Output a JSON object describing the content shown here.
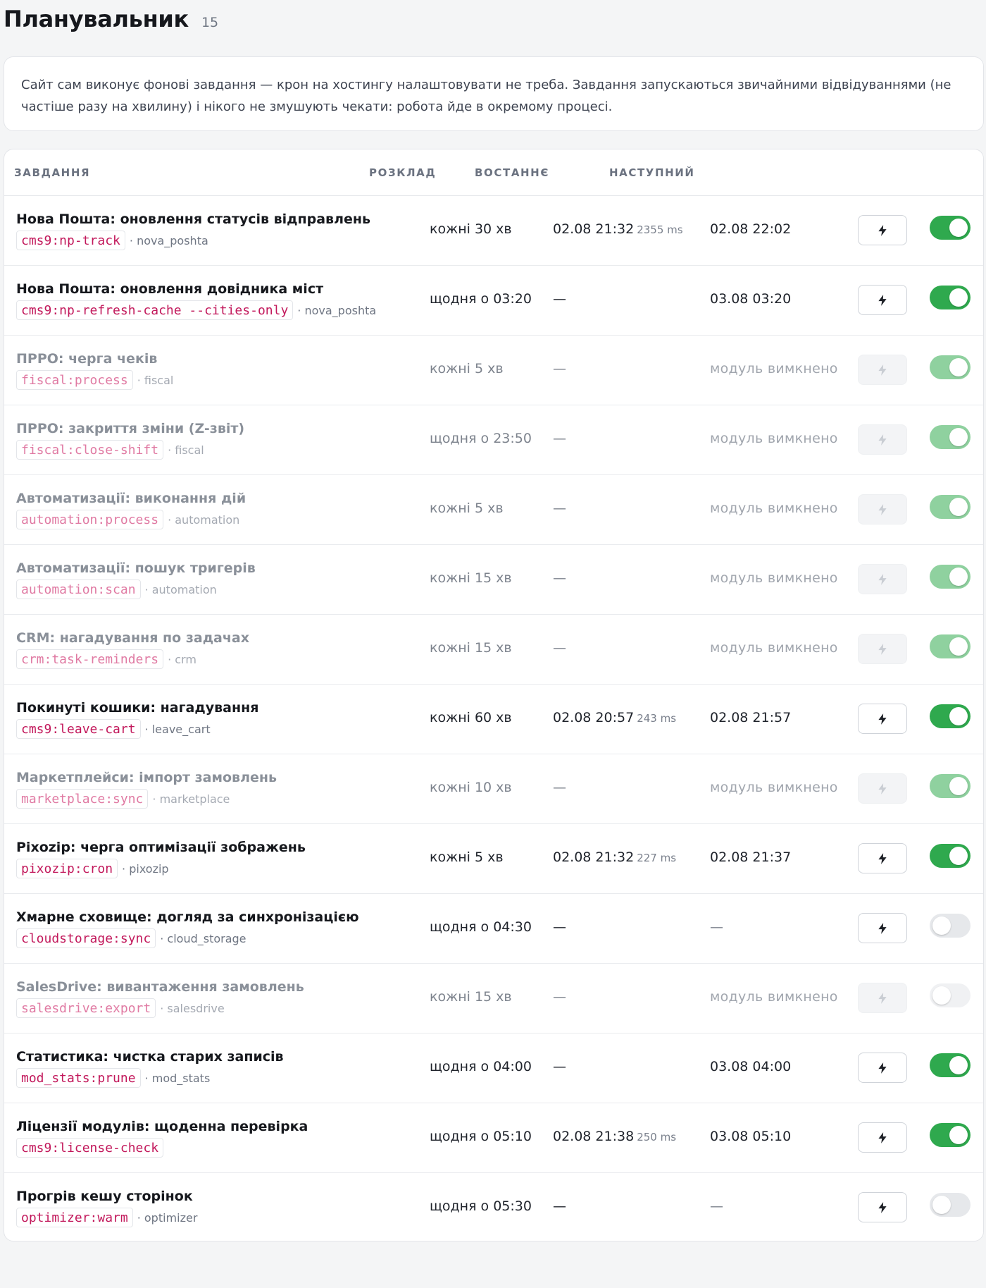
{
  "header": {
    "title": "Планувальник",
    "count": "15"
  },
  "info": {
    "text": "Сайт сам виконує фонові завдання — крон на хостингу налаштовувати не треба. Завдання запускаються звичайними відвідуваннями (не частіше разу на хвилину) і нікого не змушують чекати: робота йде в окремому процесі."
  },
  "table": {
    "columns": {
      "task": "ЗАВДАННЯ",
      "schedule": "РОЗКЛАД",
      "last": "ВОСТАННЄ",
      "next": "НАСТУПНИЙ"
    },
    "rows": [
      {
        "name": "Нова Пошта: оновлення статусів відправлень",
        "command": "cms9:np-track",
        "module": "· nova_poshta",
        "schedule": "кожні 30 хв",
        "last": "02.08 21:32",
        "duration": "2355 ms",
        "next": "02.08 22:02",
        "enabled": true,
        "module_disabled": false
      },
      {
        "name": "Нова Пошта: оновлення довідника міст",
        "command": "cms9:np-refresh-cache --cities-only",
        "module": "· nova_poshta",
        "schedule": "щодня о 03:20",
        "last": "—",
        "duration": "",
        "next": "03.08 03:20",
        "enabled": true,
        "module_disabled": false
      },
      {
        "name": "ПРРО: черга чеків",
        "command": "fiscal:process",
        "module": "· fiscal",
        "schedule": "кожні 5 хв",
        "last": "—",
        "duration": "",
        "next": "модуль вимкнено",
        "enabled": true,
        "module_disabled": true
      },
      {
        "name": "ПРРО: закриття зміни (Z-звіт)",
        "command": "fiscal:close-shift",
        "module": "· fiscal",
        "schedule": "щодня о 23:50",
        "last": "—",
        "duration": "",
        "next": "модуль вимкнено",
        "enabled": true,
        "module_disabled": true
      },
      {
        "name": "Автоматизації: виконання дій",
        "command": "automation:process",
        "module": "· automation",
        "schedule": "кожні 5 хв",
        "last": "—",
        "duration": "",
        "next": "модуль вимкнено",
        "enabled": true,
        "module_disabled": true
      },
      {
        "name": "Автоматизації: пошук тригерів",
        "command": "automation:scan",
        "module": "· automation",
        "schedule": "кожні 15 хв",
        "last": "—",
        "duration": "",
        "next": "модуль вимкнено",
        "enabled": true,
        "module_disabled": true
      },
      {
        "name": "CRM: нагадування по задачах",
        "command": "crm:task-reminders",
        "module": "· crm",
        "schedule": "кожні 15 хв",
        "last": "—",
        "duration": "",
        "next": "модуль вимкнено",
        "enabled": true,
        "module_disabled": true
      },
      {
        "name": "Покинуті кошики: нагадування",
        "command": "cms9:leave-cart",
        "module": "· leave_cart",
        "schedule": "кожні 60 хв",
        "last": "02.08 20:57",
        "duration": "243 ms",
        "next": "02.08 21:57",
        "enabled": true,
        "module_disabled": false
      },
      {
        "name": "Маркетплейси: імпорт замовлень",
        "command": "marketplace:sync",
        "module": "· marketplace",
        "schedule": "кожні 10 хв",
        "last": "—",
        "duration": "",
        "next": "модуль вимкнено",
        "enabled": true,
        "module_disabled": true
      },
      {
        "name": "Pixozip: черга оптимізації зображень",
        "command": "pixozip:cron",
        "module": "· pixozip",
        "schedule": "кожні 5 хв",
        "last": "02.08 21:32",
        "duration": "227 ms",
        "next": "02.08 21:37",
        "enabled": true,
        "module_disabled": false
      },
      {
        "name": "Хмарне сховище: догляд за синхронізацією",
        "command": "cloudstorage:sync",
        "module": "· cloud_storage",
        "schedule": "щодня о 04:30",
        "last": "—",
        "duration": "",
        "next": "—",
        "enabled": false,
        "module_disabled": false
      },
      {
        "name": "SalesDrive: вивантаження замовлень",
        "command": "salesdrive:export",
        "module": "· salesdrive",
        "schedule": "кожні 15 хв",
        "last": "—",
        "duration": "",
        "next": "модуль вимкнено",
        "enabled": false,
        "module_disabled": true
      },
      {
        "name": "Статистика: чистка старих записів",
        "command": "mod_stats:prune",
        "module": "· mod_stats",
        "schedule": "щодня о 04:00",
        "last": "—",
        "duration": "",
        "next": "03.08 04:00",
        "enabled": true,
        "module_disabled": false
      },
      {
        "name": "Ліцензії модулів: щоденна перевірка",
        "command": "cms9:license-check",
        "module": "",
        "schedule": "щодня о 05:10",
        "last": "02.08 21:38",
        "duration": "250 ms",
        "next": "03.08 05:10",
        "enabled": true,
        "module_disabled": false
      },
      {
        "name": "Прогрів кешу сторінок",
        "command": "optimizer:warm",
        "module": "· optimizer",
        "schedule": "щодня о 05:30",
        "last": "—",
        "duration": "",
        "next": "—",
        "enabled": false,
        "module_disabled": false
      }
    ]
  },
  "icons": {
    "run": "bolt-icon"
  },
  "colors": {
    "toggle_on": "#2fa94e",
    "toggle_off": "#e6e8eb",
    "command": "#c2185b"
  }
}
